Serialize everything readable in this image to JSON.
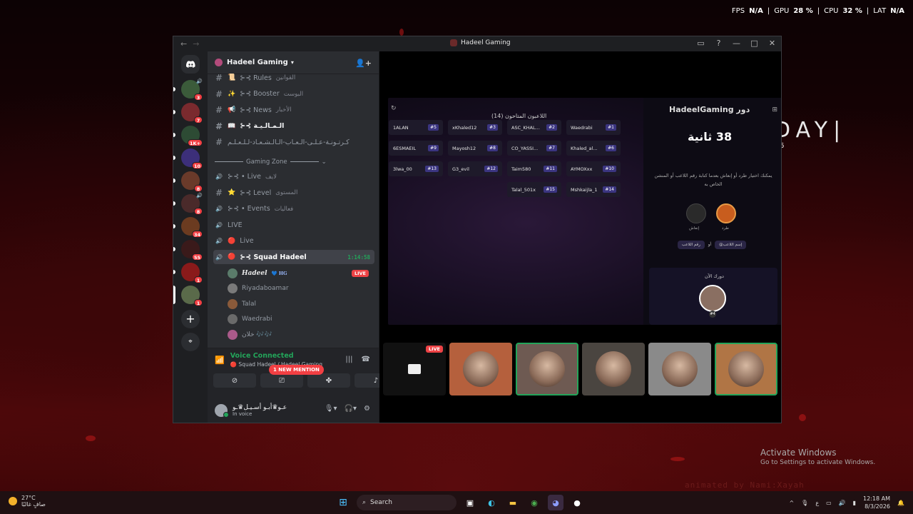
{
  "perf": {
    "fps_label": "FPS",
    "fps": "N/A",
    "gpu_label": "GPU",
    "gpu": "28 %",
    "cpu_label": "CPU",
    "cpu": "32 %",
    "lat_label": "LAT",
    "lat": "N/A"
  },
  "wallpaper": {
    "day": "DAY",
    "day_sub": "6",
    "activate_title": "Activate Windows",
    "activate_sub": "Go to Settings to activate Windows.",
    "watermark": "animated by Nami:Xayah"
  },
  "window": {
    "title": "Hadeel Gaming",
    "back": "←",
    "forward": "→"
  },
  "servers": [
    {
      "badge": "3",
      "color": "#3b5b3a",
      "speaker": true
    },
    {
      "badge": "7",
      "color": "#7a2a2e"
    },
    {
      "badge": "1K+",
      "color": "#2d4b34"
    },
    {
      "badge": "10",
      "color": "#3c2f7a"
    },
    {
      "badge": "8",
      "color": "#6a3a2a"
    },
    {
      "badge": "8",
      "color": "#4a2a2a",
      "speaker": true
    },
    {
      "badge": "34",
      "color": "#6b3b20"
    },
    {
      "badge": "55",
      "color": "#3a1a1a"
    },
    {
      "badge": "1",
      "color": "#8a1a1a"
    },
    {
      "badge": "1",
      "color": "#5a6a4a",
      "active": true
    }
  ],
  "sidebar": {
    "server_name": "Hadeel Gaming",
    "channels": [
      {
        "kind": "text",
        "emoji": "📜",
        "label": "⊱⊰ Rules",
        "arabic": "القوانين"
      },
      {
        "kind": "text",
        "emoji": "✨",
        "label": "⊱⊰ Booster",
        "arabic": "البوست"
      },
      {
        "kind": "text",
        "emoji": "📢",
        "label": "⊱⊰ News",
        "arabic": "الأخبار"
      },
      {
        "kind": "text",
        "emoji": "📖",
        "label": "⊱⊰ الـمـالـيـة",
        "arabic": "",
        "bold": true
      },
      {
        "kind": "text",
        "emoji": "",
        "label": "كـرتـونـة-عـلـى-الـعـاب-الـالـشـعـاد-لـلـعـلـم",
        "arabic": ""
      }
    ],
    "category": "Gaming Zone",
    "channels2": [
      {
        "kind": "voice",
        "label": "⊱⊰ • Live",
        "arabic": "لايف"
      },
      {
        "kind": "text",
        "emoji": "⭐",
        "label": "⊱⊰ Level",
        "arabic": "المستوى"
      },
      {
        "kind": "voice",
        "label": "⊱⊰ • Events",
        "arabic": "فعاليات"
      },
      {
        "kind": "voice",
        "label": "LIVE",
        "arabic": ""
      },
      {
        "kind": "voice",
        "emoji": "🔴",
        "label": "Live",
        "arabic": ""
      },
      {
        "kind": "voice",
        "emoji": "🔴",
        "label": "⊱⊰ Squad Hadeel",
        "arabic": "",
        "time": "1:14:58",
        "active": true
      }
    ],
    "voice_users": [
      {
        "name": "𝑯𝒂𝒅𝒆𝒆𝒍",
        "tag": "💙 HG",
        "live": "LIVE",
        "color": "#5a7b6a"
      },
      {
        "name": "Riyadaboamar",
        "color": "#7a7a7a"
      },
      {
        "name": "Talal",
        "color": "#8a5a3a"
      },
      {
        "name": "Waedrabi",
        "color": "#6a6a6a"
      },
      {
        "name": "خلان 🎶🎶",
        "color": "#aa5a8a"
      }
    ],
    "mention": "1 NEW MENTION"
  },
  "voice": {
    "status": "Voice Connected",
    "channel": "🔴 Squad Hadeel / Hadeel Gaming"
  },
  "user": {
    "name": "عـو♛أبـو أسـيـل♛ـو",
    "status": "In voice"
  },
  "stream": {
    "grid_title": "اللاعبون المتاحون (14)",
    "players": [
      {
        "name": "Waedrabi",
        "num": "#1"
      },
      {
        "name": "ASC_KHAL...",
        "num": "#2"
      },
      {
        "name": "xKhaled12",
        "num": "#3"
      },
      {
        "name": "1ALAN",
        "num": "#5"
      },
      {
        "name": "Khaled_al...",
        "num": "#6"
      },
      {
        "name": "CO_YASSI...",
        "num": "#7"
      },
      {
        "name": "Mayosh12",
        "num": "#8"
      },
      {
        "name": "6ESMAEIL",
        "num": "#9"
      },
      {
        "name": "AYMOXxx",
        "num": "#10"
      },
      {
        "name": "Taim580",
        "num": "#11"
      },
      {
        "name": "G3_evil",
        "num": "#12"
      },
      {
        "name": "3lwa_00",
        "num": "#13"
      },
      {
        "name": "Mshkaijla_1",
        "num": "#14"
      },
      {
        "name": "Talal_501x",
        "num": "#15"
      }
    ],
    "turn_header": "HadeelGaming دور",
    "countdown": "38 ثانية",
    "desc": "يمكنك اختيار طرد أو إنعاش بعدما كتابة رقم اللاعب أو المنشن الخاص به",
    "opt_revive": "إنعاش",
    "opt_kick": "طرد",
    "tag1": "@إسم اللاعب",
    "tag_or": "أو",
    "tag2": "رقم اللاعب",
    "your_turn": "دورك الآن",
    "your_badge": "#4"
  },
  "tiles": [
    {
      "kind": "screen",
      "live": "LIVE"
    },
    {
      "color": "#b5603d"
    },
    {
      "color": "#6e5a52",
      "selected": true
    },
    {
      "color": "#4a4540"
    },
    {
      "color": "#8a8a8a"
    },
    {
      "color": "#b07545",
      "selected": true
    }
  ],
  "taskbar": {
    "temp": "27°C",
    "cond": "صافٍ غالبًا",
    "search": "Search",
    "time": "12:18 AM",
    "date": "8/3/2026",
    "lang": "ع"
  }
}
